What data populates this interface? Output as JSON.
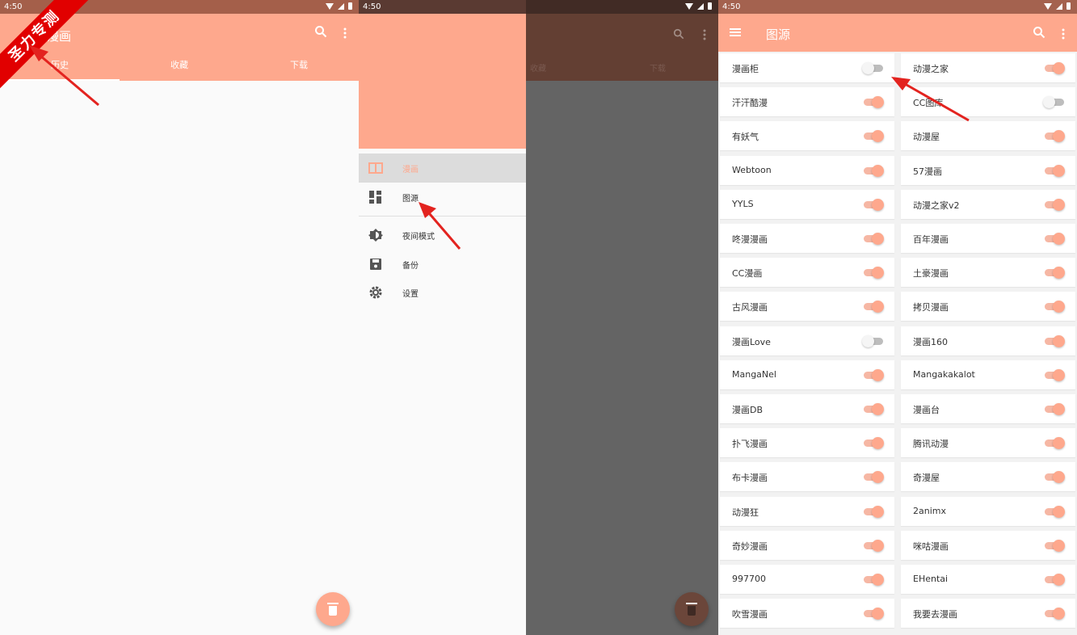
{
  "status_time": "4:50",
  "watermark": "圣力专测",
  "screen1": {
    "title": "漫画",
    "tabs": [
      "历史",
      "收藏",
      "下载"
    ],
    "icons": [
      "search-icon",
      "more-vert-icon",
      "delete-icon"
    ]
  },
  "screen2": {
    "drawer_items": [
      {
        "label": "漫画",
        "icon": "book-icon",
        "selected": true
      },
      {
        "label": "图源",
        "icon": "dashboard-icon",
        "selected": false
      },
      {
        "label": "夜间模式",
        "icon": "brightness-icon",
        "selected": false
      },
      {
        "label": "备份",
        "icon": "save-icon",
        "selected": false
      },
      {
        "label": "设置",
        "icon": "settings-icon",
        "selected": false
      }
    ],
    "background_tabs": [
      "收藏",
      "下载"
    ]
  },
  "screen3": {
    "title": "图源",
    "sources_left": [
      {
        "name": "漫画柜",
        "enabled": false
      },
      {
        "name": "汗汗酷漫",
        "enabled": true
      },
      {
        "name": "有妖气",
        "enabled": true
      },
      {
        "name": "Webtoon",
        "enabled": true
      },
      {
        "name": "YYLS",
        "enabled": true
      },
      {
        "name": "咚漫漫画",
        "enabled": true
      },
      {
        "name": "CC漫画",
        "enabled": true
      },
      {
        "name": "古风漫画",
        "enabled": true
      },
      {
        "name": "漫画Love",
        "enabled": false
      },
      {
        "name": "MangaNel",
        "enabled": true
      },
      {
        "name": "漫画DB",
        "enabled": true
      },
      {
        "name": "扑飞漫画",
        "enabled": true
      },
      {
        "name": "布卡漫画",
        "enabled": true
      },
      {
        "name": "动漫狂",
        "enabled": true
      },
      {
        "name": "奇妙漫画",
        "enabled": true
      },
      {
        "name": "997700",
        "enabled": true
      },
      {
        "name": "吹雪漫画",
        "enabled": true
      }
    ],
    "sources_right": [
      {
        "name": "动漫之家",
        "enabled": true
      },
      {
        "name": "CC图库",
        "enabled": false
      },
      {
        "name": "动漫屋",
        "enabled": true
      },
      {
        "name": "57漫画",
        "enabled": true
      },
      {
        "name": "动漫之家v2",
        "enabled": true
      },
      {
        "name": "百年漫画",
        "enabled": true
      },
      {
        "name": "土豪漫画",
        "enabled": true
      },
      {
        "name": "拷贝漫画",
        "enabled": true
      },
      {
        "name": "漫画160",
        "enabled": true
      },
      {
        "name": "Mangakakalot",
        "enabled": true
      },
      {
        "name": "漫画台",
        "enabled": true
      },
      {
        "name": "腾讯动漫",
        "enabled": true
      },
      {
        "name": "奇漫屋",
        "enabled": true
      },
      {
        "name": "2animx",
        "enabled": true
      },
      {
        "name": "咪咕漫画",
        "enabled": true
      },
      {
        "name": "EHentai",
        "enabled": true
      },
      {
        "name": "我要去漫画",
        "enabled": true
      }
    ]
  },
  "colors": {
    "primary": "#fea88d",
    "status_bar": "#a45f4a",
    "annotation": "#e3231f",
    "watermark": "#e10000"
  }
}
